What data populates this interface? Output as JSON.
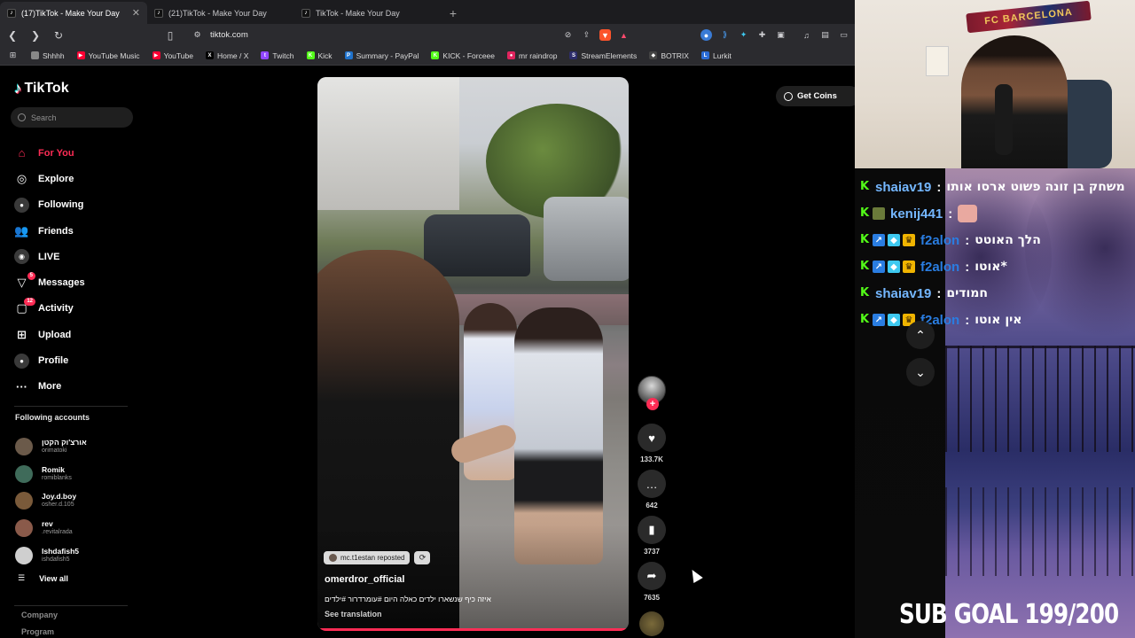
{
  "browser": {
    "tabs": [
      {
        "title": "(17)TikTok - Make Your Day",
        "active": true
      },
      {
        "title": "(21)TikTok - Make Your Day",
        "active": false
      },
      {
        "title": "TikTok - Make Your Day",
        "active": false
      }
    ],
    "close_glyph": "✕",
    "new_tab_glyph": "+",
    "url": "tiktok.com",
    "bookmarks": [
      {
        "label": "Shhhh",
        "color": "#888888",
        "glyph": ""
      },
      {
        "label": "YouTube Music",
        "color": "#ff0033",
        "glyph": "▶"
      },
      {
        "label": "YouTube",
        "color": "#ff0033",
        "glyph": "▶"
      },
      {
        "label": "Home / X",
        "color": "#000000",
        "glyph": "X"
      },
      {
        "label": "Twitch",
        "color": "#9146ff",
        "glyph": "t"
      },
      {
        "label": "Kick",
        "color": "#53fc18",
        "glyph": "K"
      },
      {
        "label": "Summary - PayPal",
        "color": "#1f72cc",
        "glyph": "P"
      },
      {
        "label": "KICK - Forceee",
        "color": "#53fc18",
        "glyph": "K"
      },
      {
        "label": "mr raindrop",
        "color": "#e0245e",
        "glyph": "●"
      },
      {
        "label": "StreamElements",
        "color": "#2d2d6b",
        "glyph": "S"
      },
      {
        "label": "BOTRIX",
        "color": "#444444",
        "glyph": "◆"
      },
      {
        "label": "Lurkit",
        "color": "#2b6cd6",
        "glyph": "L"
      }
    ]
  },
  "tiktok": {
    "logo_text": "TikTok",
    "search_placeholder": "Search",
    "nav": [
      {
        "label": "For You",
        "icon": "home-icon",
        "glyph": "⌂",
        "active": true,
        "badge": ""
      },
      {
        "label": "Explore",
        "icon": "compass-icon",
        "glyph": "◎",
        "active": false,
        "badge": ""
      },
      {
        "label": "Following",
        "icon": "following-icon",
        "glyph": "●",
        "active": false,
        "badge": ""
      },
      {
        "label": "Friends",
        "icon": "friends-icon",
        "glyph": "👥",
        "active": false,
        "badge": ""
      },
      {
        "label": "LIVE",
        "icon": "live-icon",
        "glyph": "◉",
        "active": false,
        "badge": ""
      },
      {
        "label": "Messages",
        "icon": "messages-icon",
        "glyph": "▽",
        "active": false,
        "badge": "5"
      },
      {
        "label": "Activity",
        "icon": "activity-icon",
        "glyph": "▢",
        "active": false,
        "badge": "12"
      },
      {
        "label": "Upload",
        "icon": "upload-icon",
        "glyph": "⊞",
        "active": false,
        "badge": ""
      },
      {
        "label": "Profile",
        "icon": "profile-icon",
        "glyph": "●",
        "active": false,
        "badge": ""
      },
      {
        "label": "More",
        "icon": "more-icon",
        "glyph": "···",
        "active": false,
        "badge": ""
      }
    ],
    "following_accounts_title": "Following accounts",
    "following_accounts": [
      {
        "name": "אורצ'וק הקטן",
        "handle": "orimatoki",
        "avatar_color": "#6b5a4a"
      },
      {
        "name": "Romik",
        "handle": "romiblanks",
        "avatar_color": "#3f6b5a"
      },
      {
        "name": "Joy.d.boy",
        "handle": "osher.d.105",
        "avatar_color": "#7a5a3a"
      },
      {
        "name": "rev",
        "handle": ".revitalrada",
        "avatar_color": "#8a5a4a"
      },
      {
        "name": "Ishdafish5",
        "handle": "ishdafish5",
        "avatar_color": "#cfcfcf"
      }
    ],
    "view_all_label": "View all",
    "footer_links": [
      "Company",
      "Program"
    ],
    "get_coins_label": "Get Coins",
    "video": {
      "repost_label": "mc.t1estan reposted",
      "author": "omerdror_official",
      "caption": "איזה כיף שנשארו ילדים כאלה היום #עומרדרור #ילדים",
      "see_translation": "See translation",
      "likes": "133.7K",
      "comments": "642",
      "saves": "3737",
      "shares": "7635"
    }
  },
  "stream": {
    "scarf_text": "FC BARCELONA",
    "chat": [
      {
        "user": "shaiav19",
        "user_color": "#74b7ff",
        "badges": [],
        "emote_before": false,
        "message": "משחק בן זונה פשוט ארסו אותו",
        "emote_after": false
      },
      {
        "user": "kenij441",
        "user_color": "#74b7ff",
        "badges": [],
        "emote_before": true,
        "message": "",
        "emote_after": true
      },
      {
        "user": "f2alon",
        "user_color": "#2a7de1",
        "badges": [
          "b-blue",
          "b-cyan",
          "b-gold"
        ],
        "emote_before": false,
        "message": "הלך האוטט",
        "emote_after": false
      },
      {
        "user": "f2alon",
        "user_color": "#2a7de1",
        "badges": [
          "b-blue",
          "b-cyan",
          "b-gold"
        ],
        "emote_before": false,
        "message": "אוטו*",
        "emote_after": false
      },
      {
        "user": "shaiav19",
        "user_color": "#74b7ff",
        "badges": [],
        "emote_before": false,
        "message": "חמודים",
        "emote_after": false
      },
      {
        "user": "f2alon",
        "user_color": "#2a7de1",
        "badges": [
          "b-blue",
          "b-cyan",
          "b-gold"
        ],
        "emote_before": false,
        "message": "אין אוטו",
        "emote_after": false
      }
    ],
    "sub_goal": "SUB GOAL 199/200"
  }
}
